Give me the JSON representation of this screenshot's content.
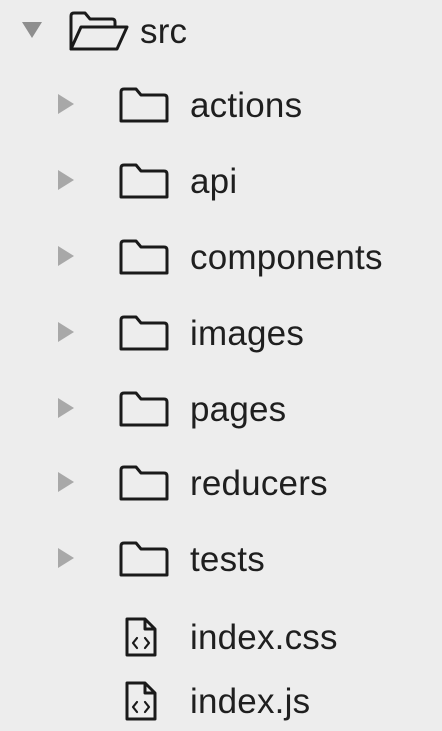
{
  "tree": {
    "root": {
      "label": "src",
      "expanded": true,
      "toggle_icon": "disclosure-triangle-down",
      "icon": "folder-open-icon"
    },
    "folders": [
      {
        "label": "actions",
        "expanded": false,
        "toggle_icon": "disclosure-triangle-right",
        "icon": "folder-icon"
      },
      {
        "label": "api",
        "expanded": false,
        "toggle_icon": "disclosure-triangle-right",
        "icon": "folder-icon"
      },
      {
        "label": "components",
        "expanded": false,
        "toggle_icon": "disclosure-triangle-right",
        "icon": "folder-icon"
      },
      {
        "label": "images",
        "expanded": false,
        "toggle_icon": "disclosure-triangle-right",
        "icon": "folder-icon"
      },
      {
        "label": "pages",
        "expanded": false,
        "toggle_icon": "disclosure-triangle-right",
        "icon": "folder-icon"
      },
      {
        "label": "reducers",
        "expanded": false,
        "toggle_icon": "disclosure-triangle-right",
        "icon": "folder-icon"
      },
      {
        "label": "tests",
        "expanded": false,
        "toggle_icon": "disclosure-triangle-right",
        "icon": "folder-icon"
      }
    ],
    "files": [
      {
        "label": "index.css",
        "icon": "code-file-icon"
      },
      {
        "label": "index.js",
        "icon": "code-file-icon"
      }
    ]
  },
  "colors": {
    "background": "#ededed",
    "text": "#1f1f1f",
    "icon_stroke": "#1a1a1a",
    "triangle_expanded": "#8e8e8e",
    "triangle_collapsed": "#a8a8a8"
  }
}
